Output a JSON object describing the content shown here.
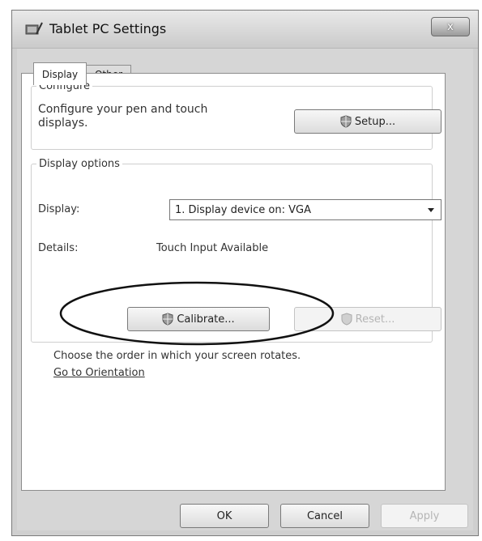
{
  "window": {
    "title": "Tablet PC Settings",
    "close_label": "x"
  },
  "tabs": [
    {
      "label": "Display",
      "active": true
    },
    {
      "label": "Other",
      "active": false
    }
  ],
  "configure": {
    "legend": "Configure",
    "description": "Configure your pen and touch displays.",
    "setup_label": "Setup..."
  },
  "display_options": {
    "legend": "Display options",
    "display_label": "Display:",
    "display_value": "1. Display device on: VGA",
    "details_label": "Details:",
    "details_value": "Touch Input Available",
    "calibrate_label": "Calibrate...",
    "reset_label": "Reset..."
  },
  "orientation": {
    "text": "Choose the order in which your screen rotates.",
    "link": "Go to Orientation"
  },
  "footer": {
    "ok_label": "OK",
    "cancel_label": "Cancel",
    "apply_label": "Apply"
  },
  "icons": {
    "app": "tablet-pc-settings-icon",
    "shield": "uac-shield-icon",
    "close": "close-icon",
    "dropdown": "chevron-down-icon"
  }
}
